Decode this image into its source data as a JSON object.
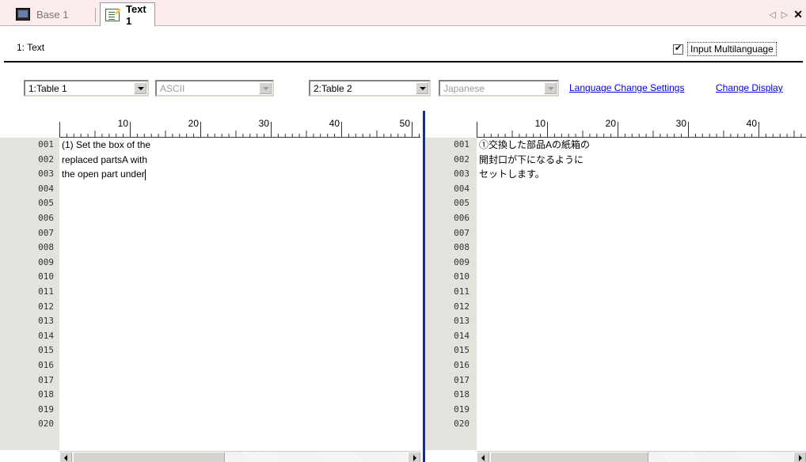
{
  "tabs": [
    {
      "label": "Base 1",
      "icon": "monitor-icon",
      "active": false
    },
    {
      "label": "Text 1",
      "icon": "text-document-icon",
      "active": true
    }
  ],
  "tab_nav": {
    "prev": "◁",
    "next": "▷",
    "close": "✕"
  },
  "header": {
    "title": "1: Text",
    "multilanguage_checked": true,
    "multilanguage_label": "Input Multilanguage"
  },
  "toolbar": {
    "left_table": "1:Table 1",
    "left_encoding": "ASCII",
    "right_table": "2:Table 2",
    "right_encoding": "Japanese",
    "language_change_settings": "Language Change Settings",
    "change_display": "Change Display"
  },
  "ruler": {
    "ticks": [
      "10",
      "20",
      "30",
      "40",
      "50"
    ]
  },
  "line_numbers": [
    "001",
    "002",
    "003",
    "004",
    "005",
    "006",
    "007",
    "008",
    "009",
    "010",
    "011",
    "012",
    "013",
    "014",
    "015",
    "016",
    "017",
    "018",
    "019",
    "020"
  ],
  "left_text": [
    "(1) Set the box of the",
    "replaced partsA with",
    "the open part under"
  ],
  "right_text": [
    "①交換した部品Aの紙箱の",
    "開封口が下になるように",
    "セットします。"
  ],
  "colors": {
    "tab_strip": "#fcebed",
    "divider": "#1e2f7a",
    "link": "#0000ee",
    "gutter_bg": "#e4e2dd"
  }
}
